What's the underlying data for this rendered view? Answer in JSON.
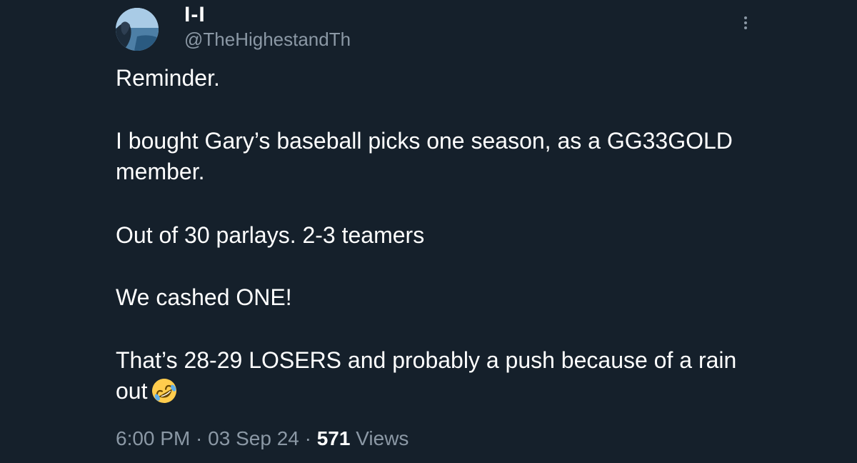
{
  "user": {
    "display_name": "I-I",
    "handle": "@TheHighestandTh",
    "avatar_icon": "avatar-image"
  },
  "menu": {
    "icon": "more-vertical-icon"
  },
  "tweet": {
    "paragraphs": [
      "Reminder.",
      "I bought Gary’s baseball picks one season, as a GG33GOLD member.",
      "Out of 30 parlays. 2-3 teamers",
      "We cashed ONE!",
      "That’s 28-29 LOSERS and probably a push because of a rain out"
    ],
    "emoji": "rolling-on-floor-laughing-emoji"
  },
  "meta": {
    "time": "6:00 PM",
    "separator": " · ",
    "date": "03 Sep 24",
    "views_count": "571",
    "views_label": " Views"
  },
  "colors": {
    "background": "#15202b",
    "text": "#ffffff",
    "secondary_text": "#8b98a5"
  }
}
